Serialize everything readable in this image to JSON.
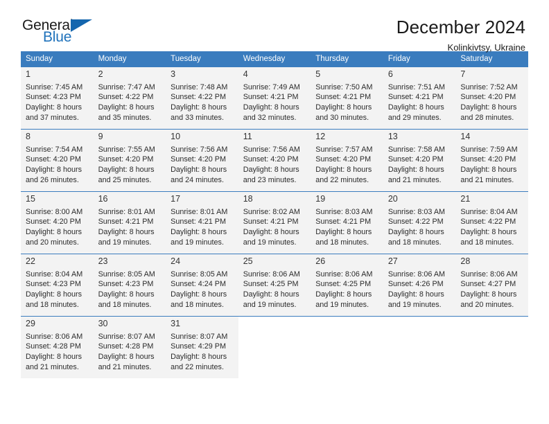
{
  "brand": {
    "logo_text_primary": "General",
    "logo_text_secondary": "Blue",
    "logo_icon": "triangle-icon",
    "accent_color": "#3a7cbe",
    "logo_blue": "#1f72bb"
  },
  "header": {
    "title": "December 2024",
    "subtitle": "Kolinkivtsy, Ukraine"
  },
  "calendar": {
    "weekday_headers": [
      "Sunday",
      "Monday",
      "Tuesday",
      "Wednesday",
      "Thursday",
      "Friday",
      "Saturday"
    ],
    "weeks": [
      [
        {
          "day": "1",
          "info": "Sunrise: 7:45 AM\nSunset: 4:23 PM\nDaylight: 8 hours\nand 37 minutes."
        },
        {
          "day": "2",
          "info": "Sunrise: 7:47 AM\nSunset: 4:22 PM\nDaylight: 8 hours\nand 35 minutes."
        },
        {
          "day": "3",
          "info": "Sunrise: 7:48 AM\nSunset: 4:22 PM\nDaylight: 8 hours\nand 33 minutes."
        },
        {
          "day": "4",
          "info": "Sunrise: 7:49 AM\nSunset: 4:21 PM\nDaylight: 8 hours\nand 32 minutes."
        },
        {
          "day": "5",
          "info": "Sunrise: 7:50 AM\nSunset: 4:21 PM\nDaylight: 8 hours\nand 30 minutes."
        },
        {
          "day": "6",
          "info": "Sunrise: 7:51 AM\nSunset: 4:21 PM\nDaylight: 8 hours\nand 29 minutes."
        },
        {
          "day": "7",
          "info": "Sunrise: 7:52 AM\nSunset: 4:20 PM\nDaylight: 8 hours\nand 28 minutes."
        }
      ],
      [
        {
          "day": "8",
          "info": "Sunrise: 7:54 AM\nSunset: 4:20 PM\nDaylight: 8 hours\nand 26 minutes."
        },
        {
          "day": "9",
          "info": "Sunrise: 7:55 AM\nSunset: 4:20 PM\nDaylight: 8 hours\nand 25 minutes."
        },
        {
          "day": "10",
          "info": "Sunrise: 7:56 AM\nSunset: 4:20 PM\nDaylight: 8 hours\nand 24 minutes."
        },
        {
          "day": "11",
          "info": "Sunrise: 7:56 AM\nSunset: 4:20 PM\nDaylight: 8 hours\nand 23 minutes."
        },
        {
          "day": "12",
          "info": "Sunrise: 7:57 AM\nSunset: 4:20 PM\nDaylight: 8 hours\nand 22 minutes."
        },
        {
          "day": "13",
          "info": "Sunrise: 7:58 AM\nSunset: 4:20 PM\nDaylight: 8 hours\nand 21 minutes."
        },
        {
          "day": "14",
          "info": "Sunrise: 7:59 AM\nSunset: 4:20 PM\nDaylight: 8 hours\nand 21 minutes."
        }
      ],
      [
        {
          "day": "15",
          "info": "Sunrise: 8:00 AM\nSunset: 4:20 PM\nDaylight: 8 hours\nand 20 minutes."
        },
        {
          "day": "16",
          "info": "Sunrise: 8:01 AM\nSunset: 4:21 PM\nDaylight: 8 hours\nand 19 minutes."
        },
        {
          "day": "17",
          "info": "Sunrise: 8:01 AM\nSunset: 4:21 PM\nDaylight: 8 hours\nand 19 minutes."
        },
        {
          "day": "18",
          "info": "Sunrise: 8:02 AM\nSunset: 4:21 PM\nDaylight: 8 hours\nand 19 minutes."
        },
        {
          "day": "19",
          "info": "Sunrise: 8:03 AM\nSunset: 4:21 PM\nDaylight: 8 hours\nand 18 minutes."
        },
        {
          "day": "20",
          "info": "Sunrise: 8:03 AM\nSunset: 4:22 PM\nDaylight: 8 hours\nand 18 minutes."
        },
        {
          "day": "21",
          "info": "Sunrise: 8:04 AM\nSunset: 4:22 PM\nDaylight: 8 hours\nand 18 minutes."
        }
      ],
      [
        {
          "day": "22",
          "info": "Sunrise: 8:04 AM\nSunset: 4:23 PM\nDaylight: 8 hours\nand 18 minutes."
        },
        {
          "day": "23",
          "info": "Sunrise: 8:05 AM\nSunset: 4:23 PM\nDaylight: 8 hours\nand 18 minutes."
        },
        {
          "day": "24",
          "info": "Sunrise: 8:05 AM\nSunset: 4:24 PM\nDaylight: 8 hours\nand 18 minutes."
        },
        {
          "day": "25",
          "info": "Sunrise: 8:06 AM\nSunset: 4:25 PM\nDaylight: 8 hours\nand 19 minutes."
        },
        {
          "day": "26",
          "info": "Sunrise: 8:06 AM\nSunset: 4:25 PM\nDaylight: 8 hours\nand 19 minutes."
        },
        {
          "day": "27",
          "info": "Sunrise: 8:06 AM\nSunset: 4:26 PM\nDaylight: 8 hours\nand 19 minutes."
        },
        {
          "day": "28",
          "info": "Sunrise: 8:06 AM\nSunset: 4:27 PM\nDaylight: 8 hours\nand 20 minutes."
        }
      ],
      [
        {
          "day": "29",
          "info": "Sunrise: 8:06 AM\nSunset: 4:28 PM\nDaylight: 8 hours\nand 21 minutes."
        },
        {
          "day": "30",
          "info": "Sunrise: 8:07 AM\nSunset: 4:28 PM\nDaylight: 8 hours\nand 21 minutes."
        },
        {
          "day": "31",
          "info": "Sunrise: 8:07 AM\nSunset: 4:29 PM\nDaylight: 8 hours\nand 22 minutes."
        },
        {
          "day": "",
          "info": ""
        },
        {
          "day": "",
          "info": ""
        },
        {
          "day": "",
          "info": ""
        },
        {
          "day": "",
          "info": ""
        }
      ]
    ]
  }
}
